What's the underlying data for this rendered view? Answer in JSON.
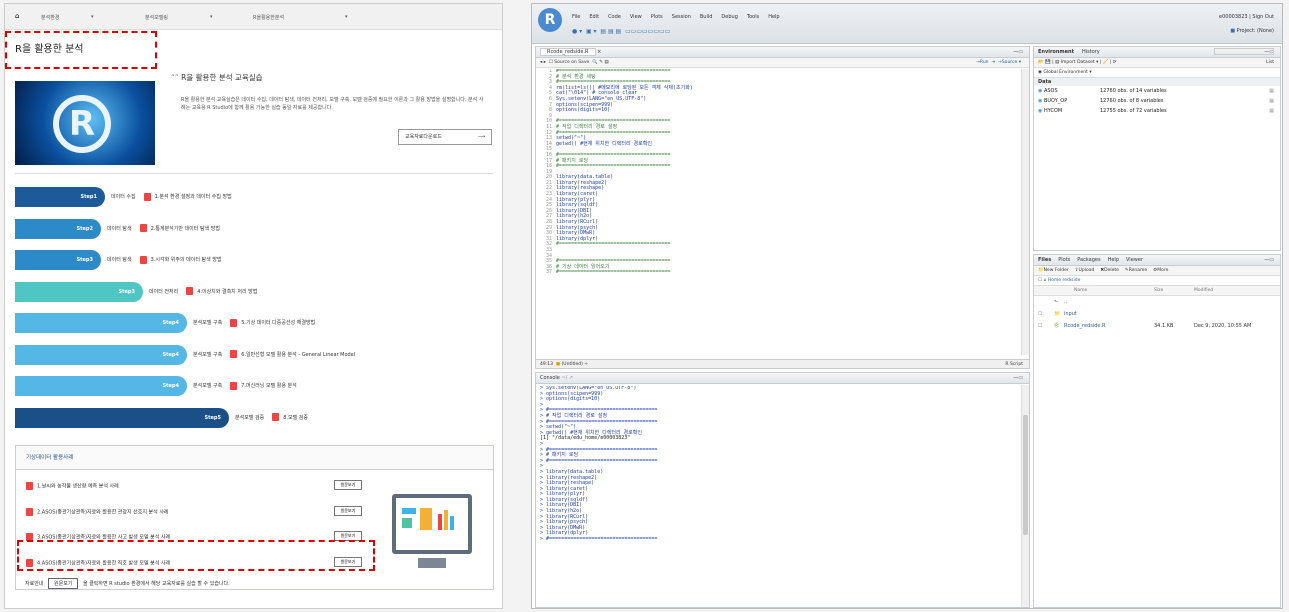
{
  "left": {
    "breadcrumb": [
      "분석환경",
      "분석모델링",
      "R을활용한분석"
    ],
    "page_title": "R을 활용한 분석",
    "section_title": "R을 활용한 분석 교육실습",
    "intro": "R을 활용한 분석 교육실습은 데이터 수집, 데이터 탐색, 데이터 전처리, 모델 구축, 모델 검증에 필요한 이론과 그 활용 방법",
    "intro2": "을 설명합니다. 분석 사례는 교육용 R Studio에 함께 활용 가능한 실습 동일 자료를 제공합니다.",
    "guide_btn": "교육자료다운로드",
    "steps": [
      {
        "step": "Step1",
        "name": "데이터 수집",
        "desc": "1.분석 환경 설정과 데이터 수집 방법"
      },
      {
        "step": "Step2",
        "name": "데이터 탐색",
        "desc": "2.통계분석기반 데이터 탐색 방법"
      },
      {
        "step": "Step3",
        "name": "데이터 탐색",
        "desc": "3.시각화 위주의 데이터 탐색 방법"
      },
      {
        "step": "Step3",
        "name": "데이터 전처리",
        "desc": "4.이상치와 결측치 처리 방법"
      },
      {
        "step": "Step4",
        "name": "분석모델 구축",
        "desc": "5.기상 데이터 다중공선성 해결방법"
      },
      {
        "step": "Step4",
        "name": "분석모델 구축",
        "desc": "6.일반선형 모델 활용 분석 - General Linear Model"
      },
      {
        "step": "Step4",
        "name": "분석모델 구축",
        "desc": "7.머신러닝 모델 활용 분석"
      },
      {
        "step": "Step5",
        "name": "분석모델 검증",
        "desc": "8.모델 검증"
      }
    ],
    "cases_title": "기상데이터 활용사례",
    "cases": [
      {
        "title": "1.날씨와 농작물 생산량 예측 분석 사례",
        "btn": "원문보기"
      },
      {
        "title": "2.ASOS(종관기상관측)자료와 활용한 관광지 선호지 분석 사례",
        "btn": "원문보기"
      },
      {
        "title": "3.ASOS(종관기상관측)자료와 활용한 사고 발생 모델 분석 사례",
        "btn": "원문보기"
      },
      {
        "title": "4.ASOS(종관기상관측)자료와 활용한 직호 발생 모델 분석 사례",
        "btn": "원문보기"
      }
    ],
    "footer_label": "자료안내",
    "footer_btn": "원문보기",
    "footer_text": "을 클릭하면 R studio 환경에서 해당 교육자료를 실습 할 수 있습니다."
  },
  "rstudio": {
    "menus": [
      "File",
      "Edit",
      "Code",
      "View",
      "Plots",
      "Session",
      "Build",
      "Debug",
      "Tools",
      "Help"
    ],
    "user": "e00003823 | Sign Out",
    "project": "Project: (None)",
    "editor_tab": "Rcode_redside.R",
    "editor_toolbar": "Source on Save",
    "run": "Run",
    "source": "Source",
    "code": [
      "#=====================================",
      "# 분석 환경 세팅",
      "#=====================================",
      "rm(list=ls()) #메모리에 로딩된 모든 객체 삭제(초기화)",
      "cat(\"\\014\") # console clear",
      "Sys.setenv(LANG=\"en_US.UTF-8\")",
      "options(scipen=999)",
      "options(digits=10)",
      "",
      "#=====================================",
      "# 작업 디렉터리 경로 설정",
      "#=====================================",
      "setwd(\"~\")",
      "getwd() #현재 위치한 디렉터리 경로확인",
      "",
      "#=====================================",
      "# 패키지 로딩",
      "#=====================================",
      "",
      "library(data.table)",
      "library(reshape2)",
      "library(reshape)",
      "library(caret)",
      "library(plyr)",
      "library(sqldf)",
      "library(DBI)",
      "library(h2o)",
      "library(RCurl)",
      "library(psych)",
      "library(DMwR)",
      "library(dplyr)",
      "#=====================================",
      "",
      "",
      "#=====================================",
      "# 기상 데이터 읽어오기",
      "#====================================="
    ],
    "editor_status": "49:13",
    "editor_status_right": "R Script",
    "console_title": "Console",
    "console": [
      "> Sys.setenv(LANG=\"en_US.UTF-8\")",
      "> options(scipen=999)",
      "> options(digits=10)",
      ">",
      "> #====================================",
      "> # 작업 디렉터리 경로 설정",
      "> #====================================",
      "> setwd(\"~\")",
      "> getwd() #현재 위치한 디렉터리 경로확인",
      "[1] \"/data/edu_home/e00003823\"",
      ">",
      "> #====================================",
      "> # 패키지 로딩",
      "> #====================================",
      ">",
      "> library(data.table)",
      "> library(reshape2)",
      "> library(reshape)",
      "> library(caret)",
      "> library(plyr)",
      "> library(sqldf)",
      "> library(DBI)",
      "> library(h2o)",
      "> library(RCurl)",
      "> library(psych)",
      "> library(DMwR)",
      "> library(dplyr)",
      "> #===================================="
    ],
    "env_tabs": [
      "Environment",
      "History"
    ],
    "env_toolbar": "Import Dataset",
    "env_scope": "Global Environment",
    "env_list": "List",
    "env_section": "Data",
    "env_rows": [
      {
        "name": "ASOS",
        "desc": "12760 obs. of 14 variables"
      },
      {
        "name": "BUOY_OP",
        "desc": "12760 obs. of 8 variables"
      },
      {
        "name": "HYCOM",
        "desc": "12755 obs. of 72 variables"
      }
    ],
    "files_tabs": [
      "Files",
      "Plots",
      "Packages",
      "Help",
      "Viewer"
    ],
    "files_toolbar": [
      "New Folder",
      "Upload",
      "Delete",
      "Rename",
      "More"
    ],
    "files_path": "Home  rediside",
    "files_cols": [
      "Name",
      "Size",
      "Modified"
    ],
    "files": [
      {
        "name": "..",
        "size": "",
        "mod": ""
      },
      {
        "name": "input",
        "size": "",
        "mod": ""
      },
      {
        "name": "Rcode_redside.R",
        "size": "34.1 KB",
        "mod": "Dec 9, 2020, 10:55 AM"
      }
    ]
  }
}
